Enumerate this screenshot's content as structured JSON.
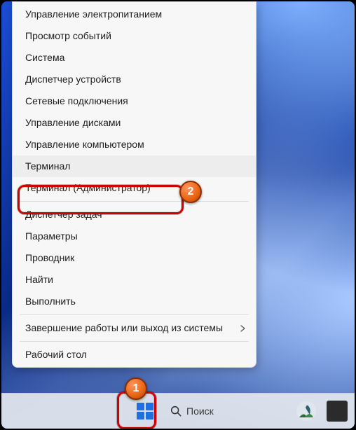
{
  "menu": {
    "items": [
      {
        "label": "Управление электропитанием"
      },
      {
        "label": "Просмотр событий"
      },
      {
        "label": "Система"
      },
      {
        "label": "Диспетчер устройств"
      },
      {
        "label": "Сетевые подключения"
      },
      {
        "label": "Управление дисками"
      },
      {
        "label": "Управление компьютером"
      },
      {
        "label": "Терминал"
      },
      {
        "label": "Терминал (Администратор)"
      },
      {
        "label": "Диспетчер задач"
      },
      {
        "label": "Параметры"
      },
      {
        "label": "Проводник"
      },
      {
        "label": "Найти"
      },
      {
        "label": "Выполнить"
      },
      {
        "label": "Завершение работы или выход из системы"
      },
      {
        "label": "Рабочий стол"
      }
    ]
  },
  "taskbar": {
    "search_label": "Поиск"
  },
  "annotations": {
    "badge1": "1",
    "badge2": "2"
  },
  "colors": {
    "highlight": "#d30000",
    "badge": "#e86412",
    "start_logo": "#1f6fe0"
  }
}
